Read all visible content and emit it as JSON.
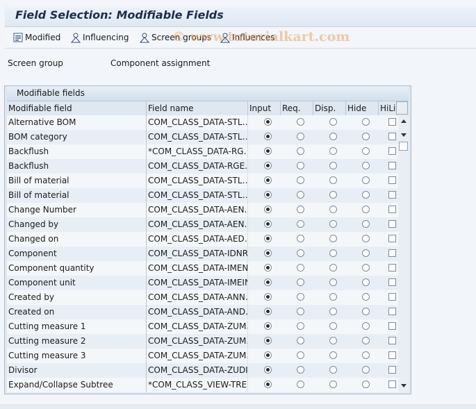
{
  "title": "Field Selection: Modifiable Fields",
  "toolbar": {
    "items": [
      {
        "label": "Modified",
        "icon": "modified-icon"
      },
      {
        "label": "Influencing",
        "icon": "person-icon"
      },
      {
        "label": "Screen groups",
        "icon": "person-icon"
      },
      {
        "label": "Influences",
        "icon": "person-icon"
      }
    ]
  },
  "watermark": "© www.tutorialkart.com",
  "screen_group": {
    "label": "Screen group",
    "value": "Component assignment"
  },
  "panel": {
    "title": "Modifiable fields",
    "columns": [
      "Modifiable field",
      "Field name",
      "Input",
      "Req.",
      "Disp.",
      "Hide",
      "HiLi"
    ],
    "rows": [
      {
        "field": "Alternative BOM",
        "name": "COM_CLASS_DATA-STL…",
        "selected": "Input",
        "hili": false
      },
      {
        "field": "BOM category",
        "name": "COM_CLASS_DATA-STL…",
        "selected": "Input",
        "hili": false
      },
      {
        "field": "Backflush",
        "name": "*COM_CLASS_DATA-RG…",
        "selected": "Input",
        "hili": false
      },
      {
        "field": "Backflush",
        "name": "COM_CLASS_DATA-RGE…",
        "selected": "Input",
        "hili": false
      },
      {
        "field": "Bill of material",
        "name": "COM_CLASS_DATA-STL…",
        "selected": "Input",
        "hili": false
      },
      {
        "field": "Bill of material",
        "name": "COM_CLASS_DATA-STL…",
        "selected": "Input",
        "hili": false
      },
      {
        "field": "Change Number",
        "name": "COM_CLASS_DATA-AEN…",
        "selected": "Input",
        "hili": false
      },
      {
        "field": "Changed by",
        "name": "COM_CLASS_DATA-AEN…",
        "selected": "Input",
        "hili": false
      },
      {
        "field": "Changed on",
        "name": "COM_CLASS_DATA-AED…",
        "selected": "Input",
        "hili": false
      },
      {
        "field": "Component",
        "name": "COM_CLASS_DATA-IDNRK",
        "selected": "Input",
        "hili": false
      },
      {
        "field": "Component quantity",
        "name": "COM_CLASS_DATA-IMEN…",
        "selected": "Input",
        "hili": false
      },
      {
        "field": "Component unit",
        "name": "COM_CLASS_DATA-IMEIN",
        "selected": "Input",
        "hili": false
      },
      {
        "field": "Created by",
        "name": "COM_CLASS_DATA-ANN…",
        "selected": "Input",
        "hili": false
      },
      {
        "field": "Created on",
        "name": "COM_CLASS_DATA-AND…",
        "selected": "Input",
        "hili": false
      },
      {
        "field": "Cutting measure 1",
        "name": "COM_CLASS_DATA-ZUM…",
        "selected": "Input",
        "hili": false
      },
      {
        "field": "Cutting measure 2",
        "name": "COM_CLASS_DATA-ZUM…",
        "selected": "Input",
        "hili": false
      },
      {
        "field": "Cutting measure 3",
        "name": "COM_CLASS_DATA-ZUM…",
        "selected": "Input",
        "hili": false
      },
      {
        "field": "Divisor",
        "name": "COM_CLASS_DATA-ZUDI…",
        "selected": "Input",
        "hili": false
      },
      {
        "field": "Expand/Collapse Subtree",
        "name": "*COM_CLASS_VIEW-TRE…",
        "selected": "Input",
        "hili": false
      }
    ]
  }
}
